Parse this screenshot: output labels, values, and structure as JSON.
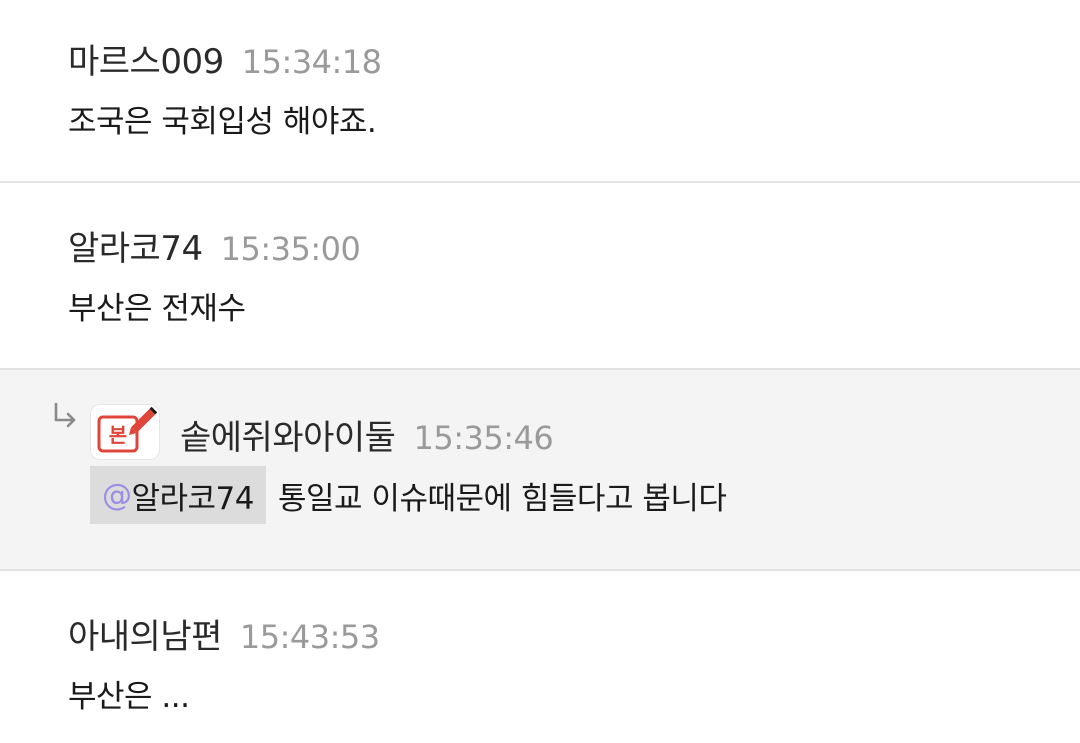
{
  "comments": [
    {
      "author": "마르스009",
      "time": "15:34:18",
      "text": "조국은 국회입성 해야죠."
    },
    {
      "author": "알라코74",
      "time": "15:35:00",
      "text": "부산은 전재수"
    },
    {
      "author": "솥에쥐와아이둘",
      "time": "15:35:46",
      "badge_text": "본",
      "mention_at": "@",
      "mention_name": "알라코74",
      "text": "통일교 이슈때문에 힘들다고 봅니다"
    },
    {
      "author": "아내의남편",
      "time": "15:43:53",
      "text": "부산은 ..."
    }
  ],
  "colors": {
    "separator": "#e2e2e2",
    "reply_background": "#f4f4f4",
    "time_text": "#9a9a9a",
    "mention_background": "#dcdcdc",
    "mention_at": "#9b8ce6",
    "badge_red": "#e0453a"
  },
  "icons": {
    "reply": "reply-arrow-icon",
    "badge": "verified-writer-badge-icon"
  }
}
